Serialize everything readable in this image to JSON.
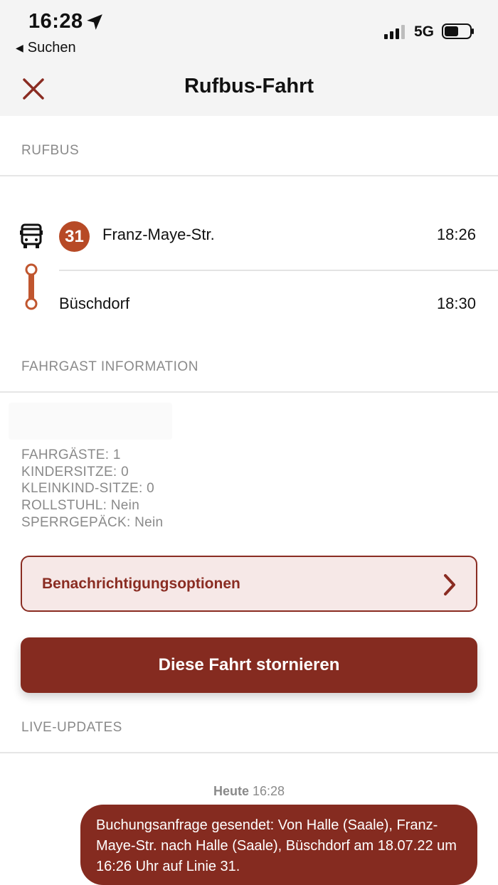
{
  "status_bar": {
    "time": "16:28",
    "back_app_label": "Suchen",
    "network": "5G"
  },
  "nav": {
    "title": "Rufbus-Fahrt"
  },
  "sections": {
    "rufbus": "RUFBUS",
    "passenger_info": "FAHRGAST INFORMATION",
    "live_updates": "LIVE-UPDATES"
  },
  "trip": {
    "line": "31",
    "stops": [
      {
        "name": "Franz-Maye-Str.",
        "time": "18:26"
      },
      {
        "name": "Büschdorf",
        "time": "18:30"
      }
    ]
  },
  "passenger_info": {
    "lines": [
      "FAHRGÄSTE: 1",
      "KINDERSITZE: 0",
      "KLEINKIND-SITZE: 0",
      "ROLLSTUHL: Nein",
      "SPERRGEPÄCK: Nein"
    ]
  },
  "actions": {
    "notification_options": "Benachrichtigungsoptionen",
    "cancel_trip": "Diese Fahrt stornieren"
  },
  "live": {
    "day": "Heute",
    "time": "16:28",
    "message": "Buchungsanfrage gesendet: Von Halle (Saale), Franz-Maye-Str. nach Halle (Saale), Büschdorf am 18.07.22 um 16:26 Uhr auf Linie 31."
  },
  "colors": {
    "accent": "#852b20",
    "badge": "#b74a26",
    "route": "#c0562f",
    "muted_text": "#8a8a8a"
  }
}
